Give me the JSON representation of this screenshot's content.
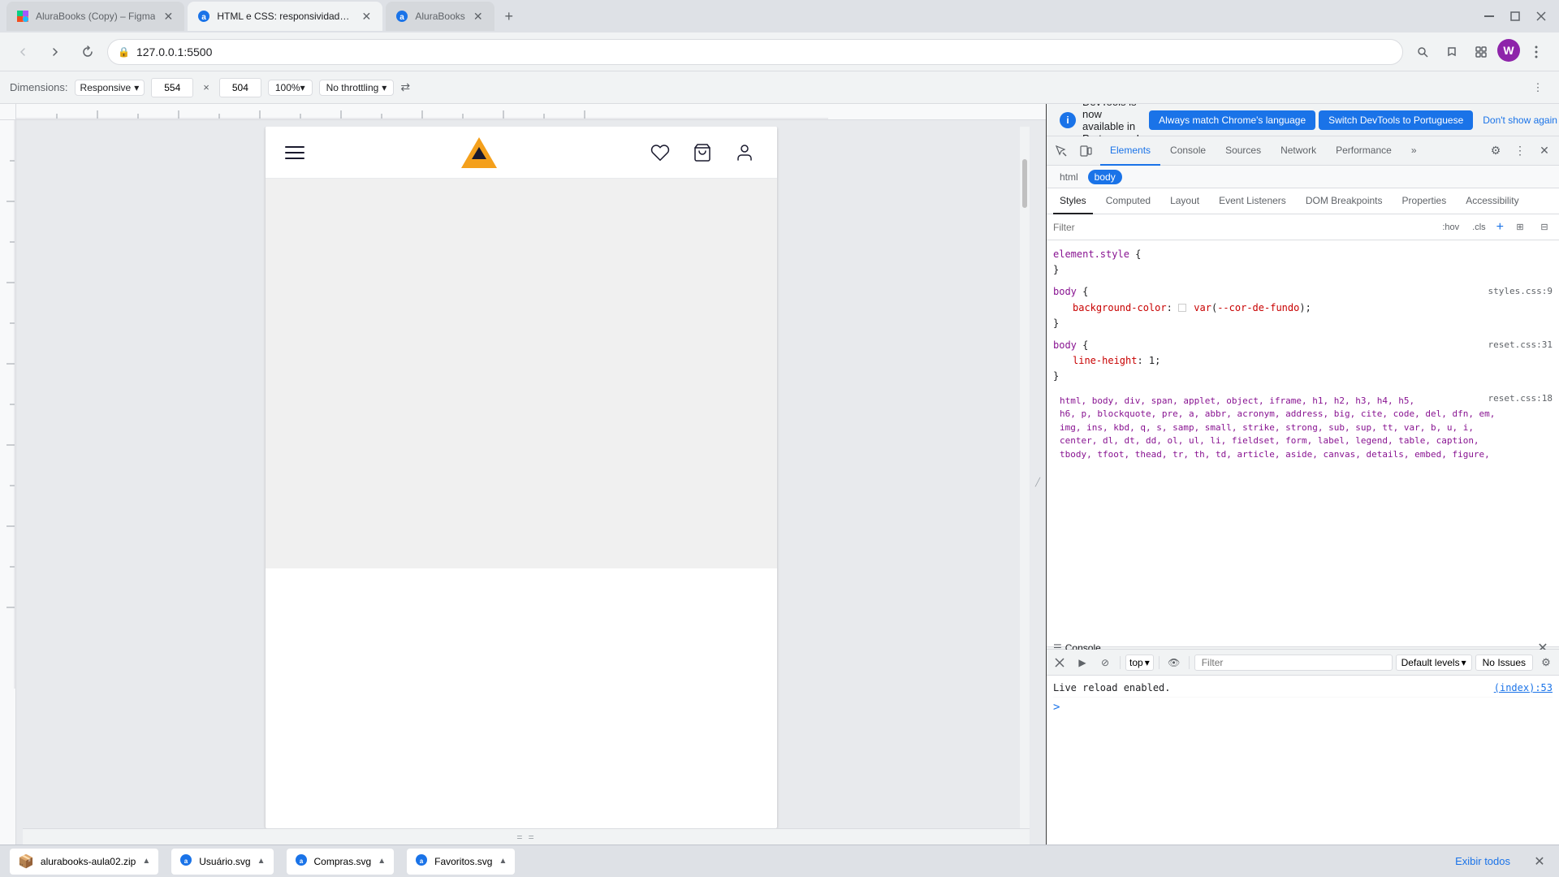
{
  "browser": {
    "tabs": [
      {
        "id": "tab1",
        "title": "AluraBooks (Copy) – Figma",
        "favicon": "figma",
        "active": false,
        "closable": true
      },
      {
        "id": "tab2",
        "title": "HTML e CSS: responsividade co...",
        "favicon": "alurabooks",
        "active": true,
        "closable": true
      },
      {
        "id": "tab3",
        "title": "AluraBooks",
        "favicon": "alurabooks2",
        "active": false,
        "closable": true
      }
    ],
    "address": "127.0.0.1:5500",
    "window_controls": {
      "minimize": "–",
      "maximize": "❐",
      "close": "✕"
    }
  },
  "toolbar": {
    "dimensions_label": "Dimensions:",
    "responsive_label": "Responsive",
    "width_value": "554",
    "height_value": "504",
    "zoom_value": "100%",
    "throttle_value": "No throttling",
    "rotate_icon": "⇄",
    "more_icon": "⋮"
  },
  "site": {
    "header_icons": [
      "☰",
      "♡",
      "🛍",
      "👤"
    ]
  },
  "devtools": {
    "notification": {
      "text": "DevTools is now available in Portuguese!",
      "match_lang_btn": "Always match Chrome's language",
      "switch_btn": "Switch DevTools to Portuguese",
      "dont_show_btn": "Don't show again"
    },
    "tabs": [
      "Elements",
      "Console",
      "Sources",
      "Network",
      "Performance",
      "»"
    ],
    "active_tab": "Elements",
    "left_icons": [
      "☰",
      "📱"
    ],
    "right_icons": [
      "⚙",
      "⋮",
      "✕"
    ],
    "html_path": [
      "html",
      "body"
    ],
    "active_path": "body",
    "styles_tabs": [
      "Styles",
      "Computed",
      "Layout",
      "Event Listeners",
      "DOM Breakpoints",
      "Properties",
      "Accessibility"
    ],
    "active_styles_tab": "Styles",
    "filter_placeholder": "Filter",
    "filter_hov": ":hov",
    "filter_cls": ".cls",
    "css_rules": [
      {
        "selector": "element.style {",
        "closing": "}",
        "properties": [],
        "file_ref": ""
      },
      {
        "selector": "body {",
        "closing": "}",
        "properties": [
          {
            "name": "background-color:",
            "value": "var(--cor-de-fundo);",
            "has_swatch": true
          }
        ],
        "file_ref": "styles.css:9"
      },
      {
        "selector": "body {",
        "closing": "}",
        "properties": [
          {
            "name": "line-height:",
            "value": "1;"
          }
        ],
        "file_ref": "reset.css:31"
      },
      {
        "selector": "html, body, div, span, applet, object, iframe, h1, h2, h3, h4, h5, h6, p, blockquote, pre, a, abbr, acronym, address, big, cite, code, del, dfn, em, img, ins, kbd, q, s, samp, small, strike, strong, sub, sup, tt, var, b, u, i, center, dl, dt, dd, ol, ul, li, fieldset, form, label, legend, table, caption, tbody, tfoot, thead, tr, th, td, article, aside, canvas, details, embed, figure,",
        "properties": [],
        "file_ref": "reset.css:18"
      }
    ]
  },
  "console": {
    "panel_label": "Console",
    "close_icon": "✕",
    "toolbar": {
      "play_icon": "▶",
      "stop_icon": "⊘",
      "top_label": "top",
      "eye_icon": "👁",
      "filter_placeholder": "Filter",
      "default_levels_label": "Default levels",
      "no_issues_label": "No Issues",
      "gear_icon": "⚙"
    },
    "messages": [
      {
        "text": "Live reload enabled.",
        "src": "(index):53"
      }
    ],
    "prompt": ">"
  },
  "downloads": [
    {
      "name": "alurabooks-aula02.zip",
      "icon": "zip"
    },
    {
      "name": "Usuário.svg",
      "icon": "svg"
    },
    {
      "name": "Compras.svg",
      "icon": "svg"
    },
    {
      "name": "Favoritos.svg",
      "icon": "svg"
    }
  ],
  "bottom_bar": {
    "show_all_label": "Exibir todos",
    "close_icon": "✕"
  }
}
